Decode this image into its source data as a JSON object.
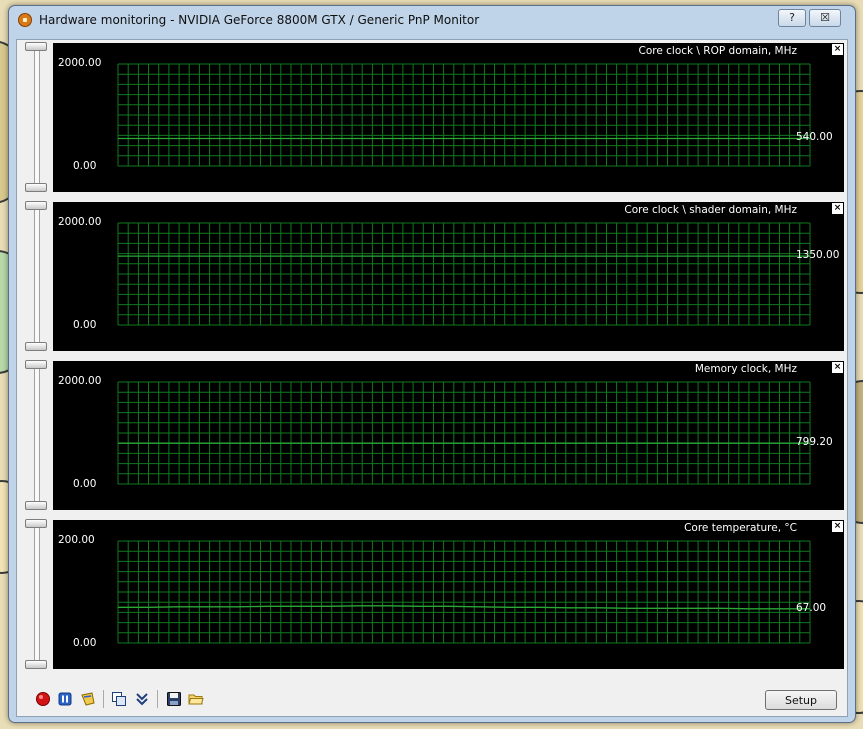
{
  "window": {
    "title": "Hardware monitoring - NVIDIA GeForce 8800M GTX / Generic PnP Monitor",
    "help_label": "?",
    "close_label": "☒"
  },
  "graphs": [
    {
      "title": "Core clock \\ ROP domain, MHz",
      "ymax_label": "2000.00",
      "ymin_label": "0.00",
      "current_label": "540.00",
      "ymax": 2000,
      "ymin": 0,
      "series": [
        540,
        540,
        540,
        540,
        540,
        540,
        540,
        540,
        540,
        540,
        540,
        540
      ]
    },
    {
      "title": "Core clock \\ shader domain, MHz",
      "ymax_label": "2000.00",
      "ymin_label": "0.00",
      "current_label": "1350.00",
      "ymax": 2000,
      "ymin": 0,
      "series": [
        1350,
        1350,
        1350,
        1350,
        1350,
        1350,
        1350,
        1350,
        1350,
        1350,
        1350,
        1350
      ]
    },
    {
      "title": "Memory clock, MHz",
      "ymax_label": "2000.00",
      "ymin_label": "0.00",
      "current_label": "799.20",
      "ymax": 2000,
      "ymin": 0,
      "series": [
        799.2,
        799.2,
        799.2,
        799.2,
        799.2,
        799.2,
        799.2,
        799.2,
        799.2,
        799.2,
        799.2,
        799.2
      ]
    },
    {
      "title": "Core temperature, °C",
      "ymax_label": "200.00",
      "ymin_label": "0.00",
      "current_label": "67.00",
      "ymax": 200,
      "ymin": 0,
      "series": [
        70,
        70,
        71,
        71,
        71,
        72,
        72,
        72,
        73,
        73,
        72,
        72,
        71,
        70,
        70,
        69,
        69,
        68,
        68,
        68,
        68,
        67,
        67,
        67
      ]
    }
  ],
  "graph_close_label": "×",
  "toolbar": {
    "icons": [
      "record-icon",
      "pause-icon",
      "clear-icon",
      "copy-icon",
      "collapse-icon",
      "save-icon",
      "open-folder-icon"
    ],
    "setup_label": "Setup"
  },
  "colors": {
    "grid": "#0f7a1e",
    "trace": "#2aa836",
    "graph_bg": "#000000"
  }
}
